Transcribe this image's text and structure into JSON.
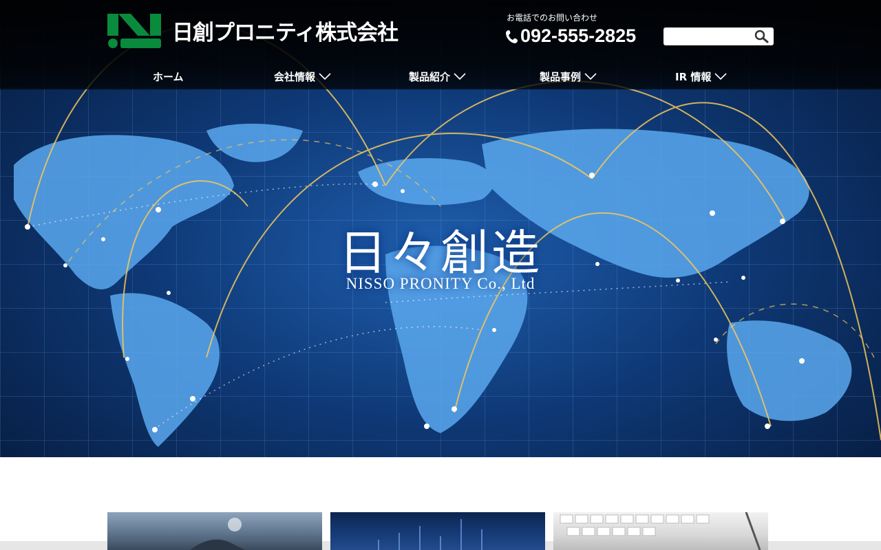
{
  "header": {
    "company_name": "日創プロニティ株式会社",
    "contact_label": "お電話でのお問い合わせ",
    "phone": "092-555-2825",
    "search_placeholder": ""
  },
  "nav": {
    "items": [
      {
        "label": "ホーム",
        "has_dropdown": false
      },
      {
        "label": "会社情報",
        "has_dropdown": true
      },
      {
        "label": "製品紹介",
        "has_dropdown": true
      },
      {
        "label": "製品事例",
        "has_dropdown": true
      },
      {
        "label": "IR 情報",
        "has_dropdown": true
      }
    ]
  },
  "hero": {
    "title": "日々創造",
    "subtitle": "NISSO PRONITY Co., Ltd"
  },
  "colors": {
    "brand_green": "#0a8a3c",
    "header_bg": "#000000",
    "hero_blue": "#1f5fae",
    "arc_gold": "#f5c85a"
  },
  "icons": [
    "logo-icon",
    "phone-icon",
    "search-icon",
    "chevron-down-icon"
  ]
}
